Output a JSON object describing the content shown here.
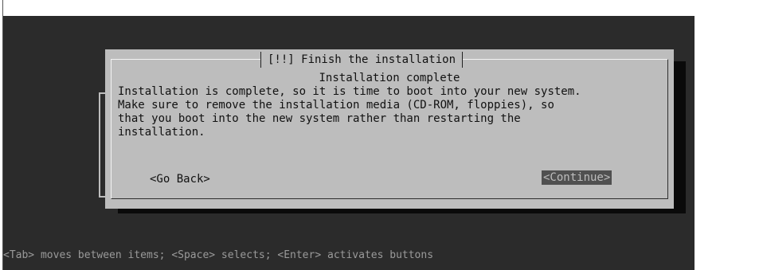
{
  "dialog": {
    "title": "[!!] Finish the installation",
    "subtitle": "Installation complete",
    "message": "Installation is complete, so it is time to boot into your new system.\nMake sure to remove the installation media (CD-ROM, floppies), so\nthat you boot into the new system rather than restarting the\ninstallation.",
    "buttons": {
      "back_label": "<Go Back>",
      "continue_label": "<Continue>"
    }
  },
  "status_bar": {
    "hint": "<Tab> moves between items; <Space> selects; <Enter> activates buttons"
  },
  "colors": {
    "background": "#2b2b2b",
    "dialog": "#bdbdbd",
    "shadow": "#0a0a0a",
    "selected_button": "#505050"
  }
}
